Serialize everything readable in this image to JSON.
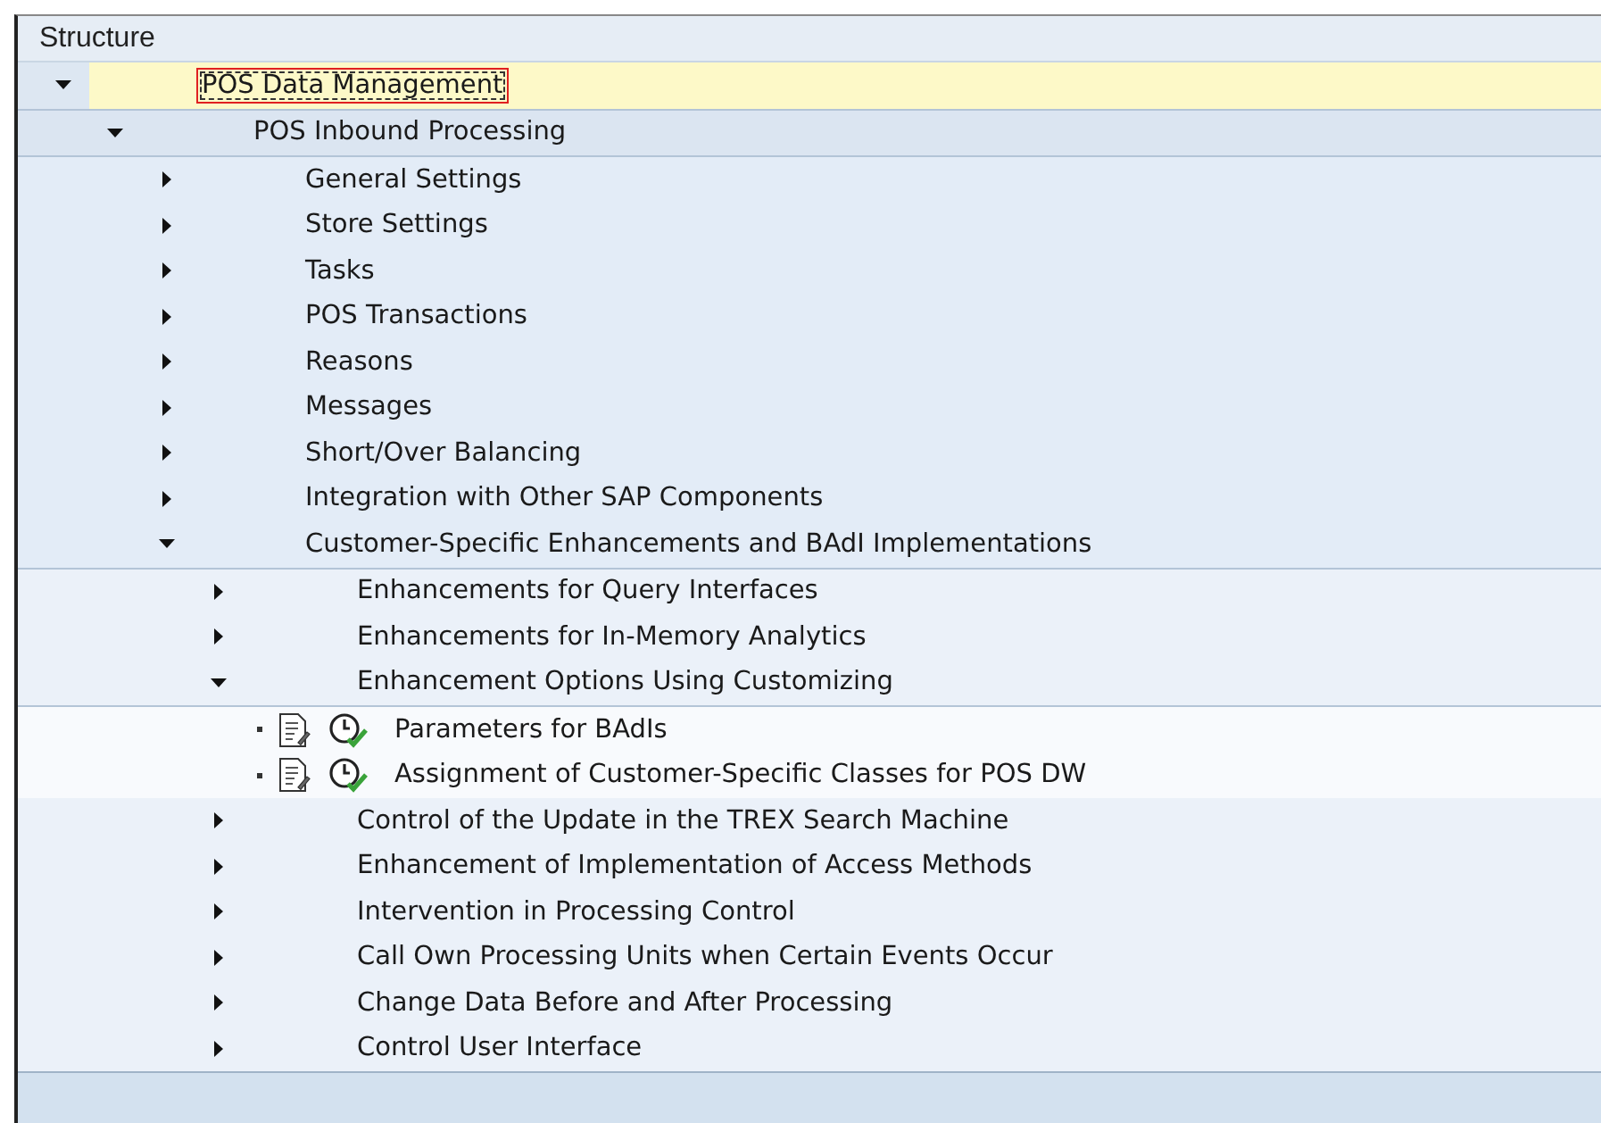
{
  "header": {
    "title": "Structure"
  },
  "tree": [
    {
      "label": "POS Data Management",
      "kind": "node",
      "expanded": true,
      "selected": true,
      "children": [
        {
          "label": "POS Inbound Processing",
          "kind": "node",
          "expanded": true,
          "selected": false,
          "children": [
            {
              "label": "General Settings",
              "kind": "node",
              "expanded": false,
              "selected": false
            },
            {
              "label": "Store Settings",
              "kind": "node",
              "expanded": false,
              "selected": false
            },
            {
              "label": "Tasks",
              "kind": "node",
              "expanded": false,
              "selected": false
            },
            {
              "label": "POS Transactions",
              "kind": "node",
              "expanded": false,
              "selected": false
            },
            {
              "label": "Reasons",
              "kind": "node",
              "expanded": false,
              "selected": false
            },
            {
              "label": "Messages",
              "kind": "node",
              "expanded": false,
              "selected": false
            },
            {
              "label": "Short/Over Balancing",
              "kind": "node",
              "expanded": false,
              "selected": false
            },
            {
              "label": "Integration with Other SAP Components",
              "kind": "node",
              "expanded": false,
              "selected": false
            },
            {
              "label": "Customer-Specific Enhancements and BAdI Implementations",
              "kind": "node",
              "expanded": true,
              "selected": false,
              "children": [
                {
                  "label": "Enhancements for Query Interfaces",
                  "kind": "node",
                  "expanded": false,
                  "selected": false
                },
                {
                  "label": "Enhancements for In-Memory Analytics",
                  "kind": "node",
                  "expanded": false,
                  "selected": false
                },
                {
                  "label": "Enhancement Options Using Customizing",
                  "kind": "node",
                  "expanded": true,
                  "selected": false,
                  "children": [
                    {
                      "label": "Parameters for BAdIs",
                      "kind": "leaf",
                      "selected": false
                    },
                    {
                      "label": "Assignment of Customer-Specific Classes for POS DW",
                      "kind": "leaf",
                      "selected": false
                    }
                  ]
                },
                {
                  "label": "Control of the Update in the TREX Search Machine",
                  "kind": "node",
                  "expanded": false,
                  "selected": false
                },
                {
                  "label": "Enhancement of Implementation of Access Methods",
                  "kind": "node",
                  "expanded": false,
                  "selected": false
                },
                {
                  "label": "Intervention in Processing Control",
                  "kind": "node",
                  "expanded": false,
                  "selected": false
                },
                {
                  "label": "Call Own Processing Units when Certain Events Occur",
                  "kind": "node",
                  "expanded": false,
                  "selected": false
                },
                {
                  "label": "Change Data Before and After Processing",
                  "kind": "node",
                  "expanded": false,
                  "selected": false
                },
                {
                  "label": "Control User Interface",
                  "kind": "node",
                  "expanded": false,
                  "selected": false
                }
              ]
            }
          ]
        }
      ]
    }
  ]
}
